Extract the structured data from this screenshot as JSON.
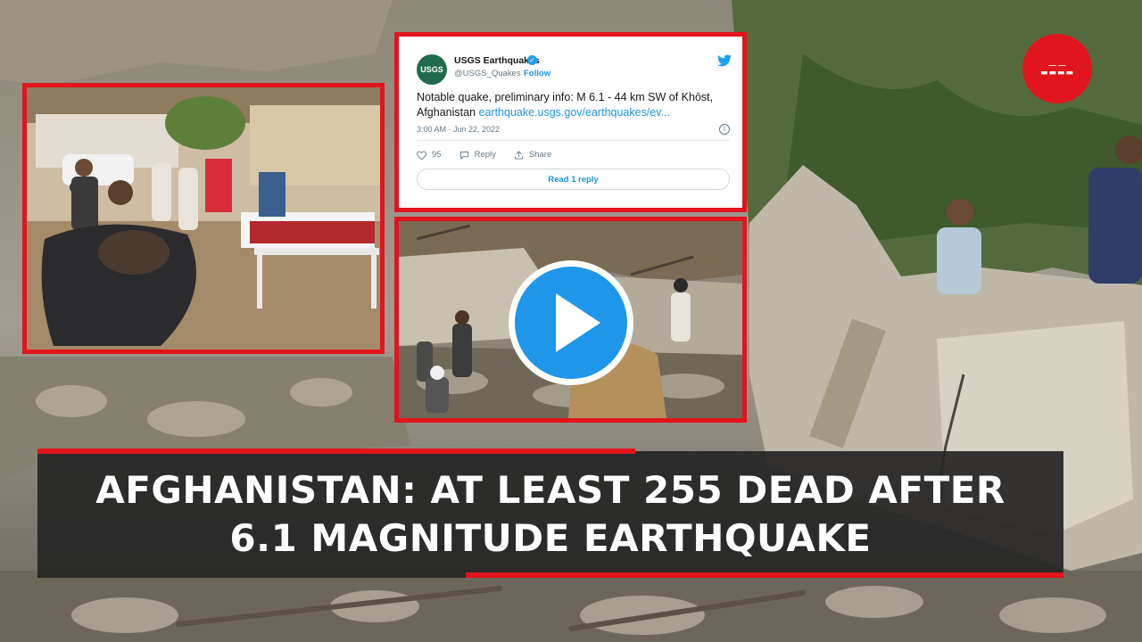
{
  "video": {
    "headline_line1": "AFGHANISTAN: AT LEAST 255 DEAD AFTER",
    "headline_line2": "6.1 MAGNITUDE EARTHQUAKE",
    "accent_color": "#e2141c"
  },
  "tweet": {
    "avatar_text": "USGS",
    "account_name": "USGS Earthquakes",
    "verified_mark": "✓",
    "handle": "@USGS_Quakes",
    "follow_label": "Follow",
    "text": "Notable quake, preliminary info: M 6.1 - 44 km SW of Khōst, Afghanistan ",
    "link": "earthquake.usgs.gov/earthquakes/ev...",
    "timestamp": "3:00 AM · Jun 22, 2022",
    "info_icon": "i",
    "like_count": "95",
    "reply_label": "Reply",
    "share_label": "Share",
    "read_replies_label": "Read 1 reply"
  },
  "logo": {
    "line1": "ـــ ـــ",
    "line2": "▬▬▬▬"
  },
  "icons": [
    "twitter-bird-icon",
    "heart-icon",
    "reply-icon",
    "share-icon",
    "info-icon",
    "play-icon",
    "channel-logo"
  ]
}
